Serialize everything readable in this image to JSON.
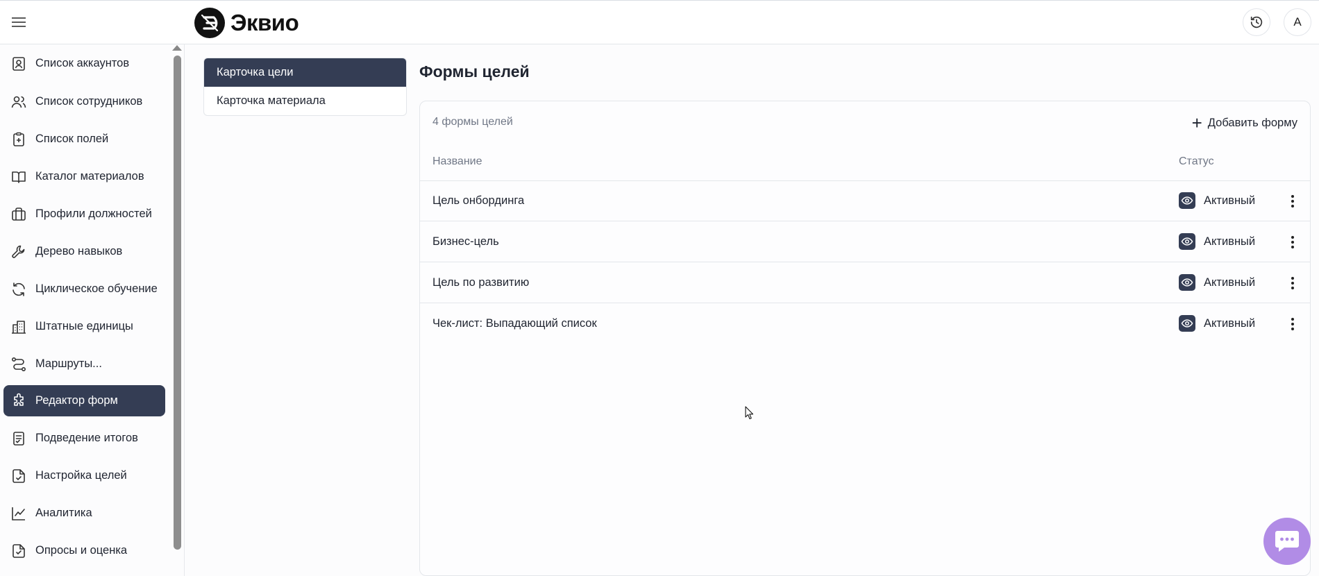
{
  "app": {
    "logo_text": "Эквио",
    "avatar_letter": "А"
  },
  "sidebar": {
    "items": [
      {
        "label": "Список аккаунтов",
        "icon": "account-icon",
        "active": false
      },
      {
        "label": "Список сотрудников",
        "icon": "users-icon",
        "active": false
      },
      {
        "label": "Список полей",
        "icon": "clipboard-plus-icon",
        "active": false
      },
      {
        "label": "Каталог материалов",
        "icon": "book-icon",
        "active": false
      },
      {
        "label": "Профили должностей",
        "icon": "briefcase-icon",
        "active": false
      },
      {
        "label": "Дерево навыков",
        "icon": "wrench-icon",
        "active": false
      },
      {
        "label": "Циклическое обучение",
        "icon": "refresh-icon",
        "active": false
      },
      {
        "label": "Штатные единицы",
        "icon": "building-icon",
        "active": false
      },
      {
        "label": "Маршруты...",
        "icon": "route-icon",
        "active": false
      },
      {
        "label": "Редактор форм",
        "icon": "puzzle-icon",
        "active": true
      },
      {
        "label": "Подведение итогов",
        "icon": "document-check-icon",
        "active": false
      },
      {
        "label": "Настройка целей",
        "icon": "file-check-icon",
        "active": false
      },
      {
        "label": "Аналитика",
        "icon": "chart-line-icon",
        "active": false
      },
      {
        "label": "Опросы и оценка",
        "icon": "survey-icon",
        "active": false
      }
    ]
  },
  "subnav": {
    "items": [
      {
        "label": "Карточка цели",
        "active": true
      },
      {
        "label": "Карточка материала",
        "active": false
      }
    ]
  },
  "main": {
    "title": "Формы целей",
    "count_text": "4 формы целей",
    "add_label": "Добавить форму",
    "columns": {
      "name": "Название",
      "status": "Статус"
    },
    "rows": [
      {
        "name": "Цель онбординга",
        "status": "Активный"
      },
      {
        "name": "Бизнес-цель",
        "status": "Активный"
      },
      {
        "name": "Цель по развитию",
        "status": "Активный"
      },
      {
        "name": "Чек-лист: Выпадающий список",
        "status": "Активный"
      }
    ]
  },
  "colors": {
    "accent": "#343d54",
    "chat_fab": "#b18ce6"
  }
}
